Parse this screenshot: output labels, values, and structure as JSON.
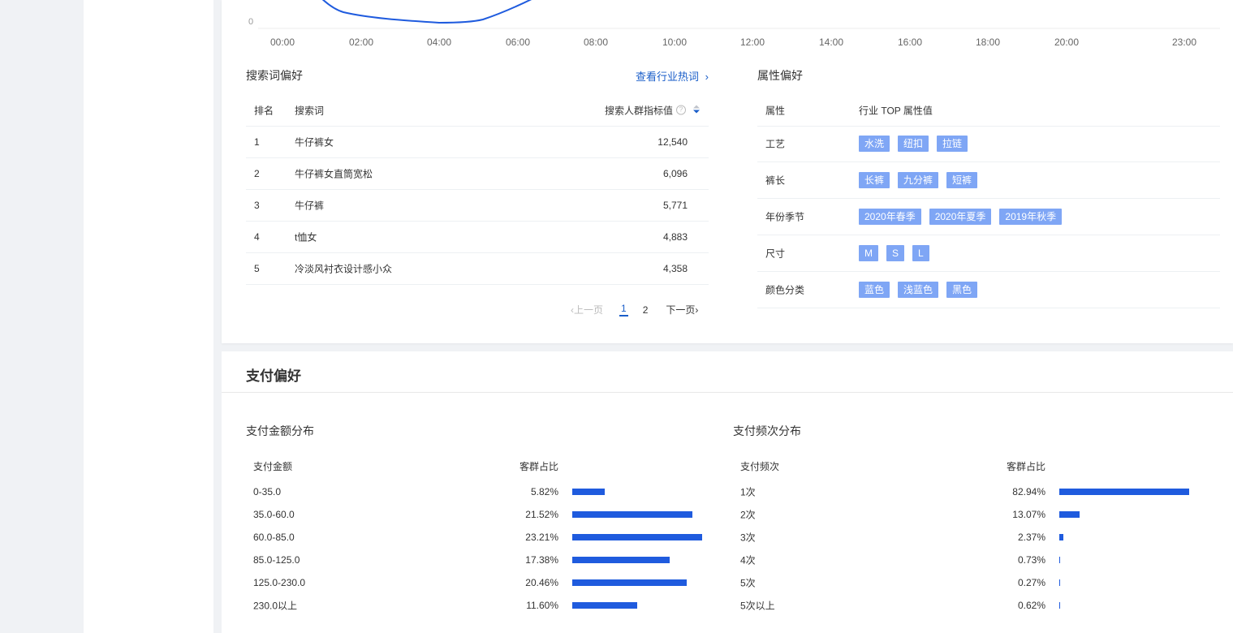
{
  "chart_data": {
    "type": "line",
    "y_axis_visible_tick": "0",
    "x_ticks": [
      "00:00",
      "02:00",
      "04:00",
      "06:00",
      "08:00",
      "10:00",
      "12:00",
      "14:00",
      "16:00",
      "18:00",
      "20:00",
      "23:00"
    ],
    "series_color": "#1f5bde"
  },
  "search": {
    "title": "搜索词偏好",
    "link": "查看行业热词",
    "headers": {
      "rank": "排名",
      "word": "搜索词",
      "value": "搜索人群指标值"
    },
    "rows": [
      {
        "rank": "1",
        "word": "牛仔裤女",
        "value": "12,540"
      },
      {
        "rank": "2",
        "word": "牛仔裤女直筒宽松",
        "value": "6,096"
      },
      {
        "rank": "3",
        "word": "牛仔裤",
        "value": "5,771"
      },
      {
        "rank": "4",
        "word": "t恤女",
        "value": "4,883"
      },
      {
        "rank": "5",
        "word": "冷淡风衬衣设计感小众",
        "value": "4,358"
      }
    ],
    "pager": {
      "prev": "上一页",
      "pages": [
        "1",
        "2"
      ],
      "next": "下一页"
    }
  },
  "attr": {
    "title": "属性偏好",
    "headers": {
      "name": "属性",
      "value": "行业 TOP 属性值"
    },
    "rows": [
      {
        "name": "工艺",
        "tags": [
          "水洗",
          "纽扣",
          "拉链"
        ]
      },
      {
        "name": "裤长",
        "tags": [
          "长裤",
          "九分裤",
          "短裤"
        ]
      },
      {
        "name": "年份季节",
        "tags": [
          "2020年春季",
          "2020年夏季",
          "2019年秋季"
        ]
      },
      {
        "name": "尺寸",
        "tags": [
          "M",
          "S",
          "L"
        ]
      },
      {
        "name": "颜色分类",
        "tags": [
          "蓝色",
          "浅蓝色",
          "黑色"
        ]
      }
    ]
  },
  "pay": {
    "title": "支付偏好",
    "amount": {
      "title": "支付金额分布",
      "headers": {
        "label": "支付金额",
        "pct": "客群占比"
      },
      "rows": [
        {
          "label": "0-35.0",
          "pct": "5.82%",
          "value": 5.82
        },
        {
          "label": "35.0-60.0",
          "pct": "21.52%",
          "value": 21.52
        },
        {
          "label": "60.0-85.0",
          "pct": "23.21%",
          "value": 23.21
        },
        {
          "label": "85.0-125.0",
          "pct": "17.38%",
          "value": 17.38
        },
        {
          "label": "125.0-230.0",
          "pct": "20.46%",
          "value": 20.46
        },
        {
          "label": "230.0以上",
          "pct": "11.60%",
          "value": 11.6
        }
      ]
    },
    "freq": {
      "title": "支付频次分布",
      "headers": {
        "label": "支付频次",
        "pct": "客群占比"
      },
      "rows": [
        {
          "label": "1次",
          "pct": "82.94%",
          "value": 82.94
        },
        {
          "label": "2次",
          "pct": "13.07%",
          "value": 13.07
        },
        {
          "label": "3次",
          "pct": "2.37%",
          "value": 2.37
        },
        {
          "label": "4次",
          "pct": "0.73%",
          "value": 0.73
        },
        {
          "label": "5次",
          "pct": "0.27%",
          "value": 0.27
        },
        {
          "label": "5次以上",
          "pct": "0.62%",
          "value": 0.62
        }
      ]
    }
  }
}
